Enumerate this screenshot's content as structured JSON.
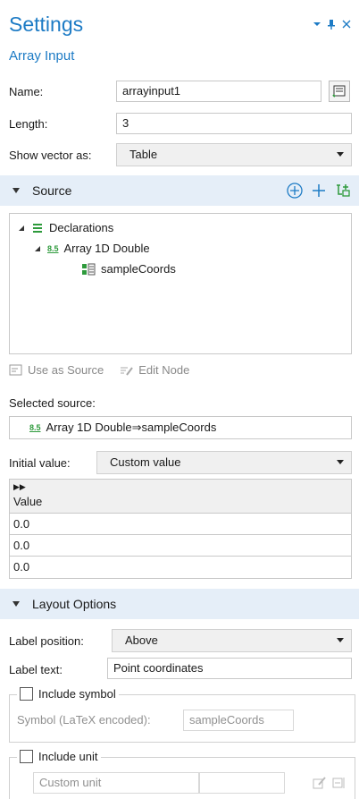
{
  "panel": {
    "title": "Settings",
    "subtitle": "Array Input"
  },
  "icons": {
    "dropdown": "chevron-down-icon",
    "pin": "pin-icon",
    "close": "close-icon"
  },
  "fields": {
    "name_label": "Name:",
    "name_value": "arrayinput1",
    "length_label": "Length:",
    "length_value": "3",
    "show_vector_label": "Show vector as:",
    "show_vector_value": "Table"
  },
  "source": {
    "header": "Source",
    "tree": [
      {
        "label": "Declarations",
        "level": 0
      },
      {
        "label": "Array 1D Double",
        "level": 1
      },
      {
        "label": "sampleCoords",
        "level": 2
      }
    ],
    "use_as_source": "Use as Source",
    "edit_node": "Edit Node",
    "selected_label": "Selected source:",
    "selected_value": "Array 1D Double⇒sampleCoords",
    "initial_label": "Initial value:",
    "initial_value": "Custom value",
    "table_header": "Value",
    "values": [
      "0.0",
      "0.0",
      "0.0"
    ]
  },
  "layout": {
    "header": "Layout Options",
    "label_position_label": "Label position:",
    "label_position_value": "Above",
    "label_text_label": "Label text:",
    "label_text_value": "Point coordinates",
    "include_symbol": "Include symbol",
    "symbol_label": "Symbol (LaTeX encoded):",
    "symbol_value": "sampleCoords",
    "include_unit": "Include unit",
    "unit_placeholder": "Custom unit"
  },
  "badge": "8.5",
  "colors": {
    "accent": "#1d7bc5",
    "section_bg": "#e5eef8",
    "green": "#2e9a3c"
  }
}
